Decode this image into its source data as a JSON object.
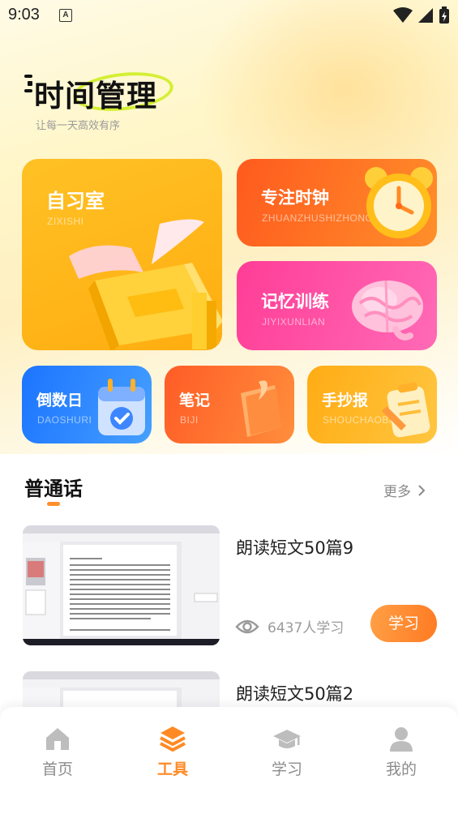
{
  "status_bar": {
    "time": "9:03",
    "notification_icon": "a-square-icon"
  },
  "header": {
    "title": "时间管理",
    "subtitle": "让每一天高效有序"
  },
  "tools": {
    "study_room": {
      "title": "自习室",
      "subtitle": "ZIXISHI"
    },
    "focus_clock": {
      "title": "专注时钟",
      "subtitle": "ZHUANZHUSHIZHONG"
    },
    "memory": {
      "title": "记忆训练",
      "subtitle": "JIYIXUNLIAN"
    },
    "countdown": {
      "title": "倒数日",
      "subtitle": "DAOSHURI"
    },
    "notes": {
      "title": "笔记",
      "subtitle": "BIJI"
    },
    "paper": {
      "title": "手抄报",
      "subtitle": "SHOUCHAOBAO"
    }
  },
  "section": {
    "title": "普通话",
    "more_label": "更多"
  },
  "courses": [
    {
      "title": "朗读短文50篇9",
      "learners": "6437人学习",
      "button": "学习"
    },
    {
      "title": "朗读短文50篇2"
    }
  ],
  "nav": {
    "items": [
      {
        "label": "首页",
        "icon": "home-icon"
      },
      {
        "label": "工具",
        "icon": "layers-icon"
      },
      {
        "label": "学习",
        "icon": "graduation-cap-icon"
      },
      {
        "label": "我的",
        "icon": "user-icon"
      }
    ],
    "active_index": 1
  },
  "colors": {
    "accent": "#ff8a24",
    "nav_inactive": "#8c8c8c"
  }
}
